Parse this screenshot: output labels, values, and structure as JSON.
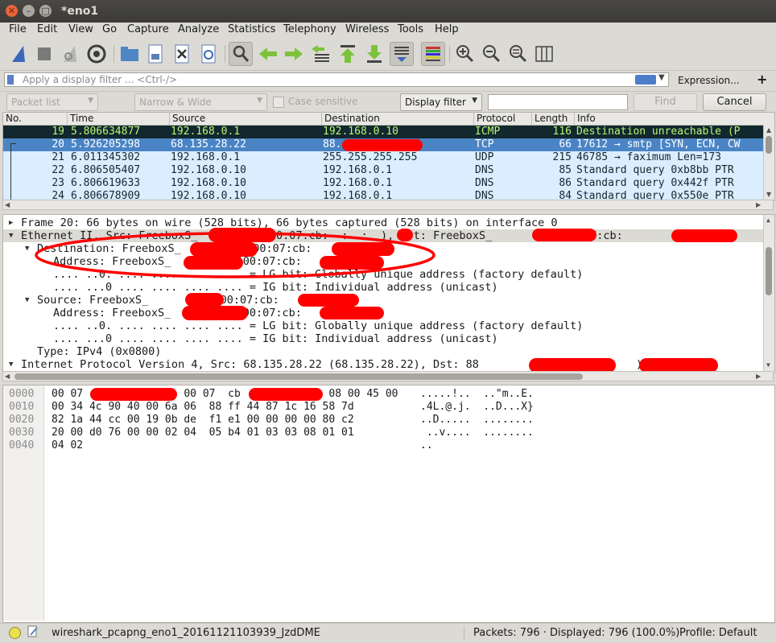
{
  "window": {
    "title": "*eno1"
  },
  "menu": [
    "File",
    "Edit",
    "View",
    "Go",
    "Capture",
    "Analyze",
    "Statistics",
    "Telephony",
    "Wireless",
    "Tools",
    "Help"
  ],
  "toolbar_icons": [
    "shark-fin-start-icon",
    "stop-square-icon",
    "restart-fin-icon",
    "gear-options-icon",
    "folder-open-icon",
    "file-save-icon",
    "file-close-icon",
    "reload-icon",
    "search-magnifier-icon",
    "arrow-back-icon",
    "arrow-forward-icon",
    "jump-to-packet-icon",
    "go-first-icon",
    "go-last-icon",
    "autoscroll-icon",
    "colorize-icon",
    "zoom-in-icon",
    "zoom-out-icon",
    "zoom-normal-icon",
    "resize-columns-icon"
  ],
  "filter": {
    "placeholder": "Apply a display filter ... <Ctrl-/>",
    "expression_label": "Expression...",
    "add_label": "+"
  },
  "find": {
    "search_in": "Packet list",
    "char_width": "Narrow & Wide",
    "case_label": "Case sensitive",
    "search_type": "Display filter",
    "find_label": "Find",
    "cancel_label": "Cancel"
  },
  "packet_list": {
    "columns": [
      "No.",
      "Time",
      "Source",
      "Destination",
      "Protocol",
      "Length",
      "Info"
    ],
    "rows": [
      {
        "no": "19",
        "time": "5.806634877",
        "src": "192.168.0.1",
        "dst": "192.168.0.10",
        "proto": "ICMP",
        "len": "116",
        "info": "Destination unreachable (P",
        "style": "icmp"
      },
      {
        "no": "20",
        "time": "5.926205298",
        "src": "68.135.28.22",
        "dst": "88.",
        "proto": "TCP",
        "len": "66",
        "info": "17612 → smtp [SYN, ECN, CW",
        "style": "selected"
      },
      {
        "no": "21",
        "time": "6.011345302",
        "src": "192.168.0.1",
        "dst": "255.255.255.255",
        "proto": "UDP",
        "len": "215",
        "info": "46785 → faximum  Len=173",
        "style": "udp"
      },
      {
        "no": "22",
        "time": "6.806505407",
        "src": "192.168.0.10",
        "dst": "192.168.0.1",
        "proto": "DNS",
        "len": "85",
        "info": "Standard query 0xb8bb PTR",
        "style": "udp"
      },
      {
        "no": "23",
        "time": "6.806619633",
        "src": "192.168.0.10",
        "dst": "192.168.0.1",
        "proto": "DNS",
        "len": "86",
        "info": "Standard query 0x442f PTR",
        "style": "udp"
      },
      {
        "no": "24",
        "time": "6.806678909",
        "src": "192.168.0.10",
        "dst": "192.168.0.1",
        "proto": "DNS",
        "len": "84",
        "info": "Standard query 0x550e PTR",
        "style": "udp"
      }
    ]
  },
  "details": [
    {
      "text": "Frame 20: 66 bytes on wire (528 bits), 66 bytes captured (528 bits) on interface 0",
      "indent": 0,
      "tri": "collapsed"
    },
    {
      "text": "Ethernet II, Src: FreeboxS_          (00:07:cb:  :  :  ), Dst: FreeboxS_          (00:07:cb:",
      "indent": 0,
      "tri": "expanded",
      "selected": true
    },
    {
      "text": "Destination: FreeboxS_          (00:07:cb:         )",
      "indent": 1,
      "tri": "expanded"
    },
    {
      "text": "Address: FreeboxS_          (00:07:cb:         )",
      "indent": 2,
      "tri": "none"
    },
    {
      "text": ".... ..0. .... .... .... .... = LG bit: Globally unique address (factory default)",
      "indent": 2,
      "tri": "none"
    },
    {
      "text": ".... ...0 .... .... .... .... = IG bit: Individual address (unicast)",
      "indent": 2,
      "tri": "none"
    },
    {
      "text": "Source: FreeboxS_          (00:07:cb:         )",
      "indent": 1,
      "tri": "expanded"
    },
    {
      "text": "Address: FreeboxS_          (00:07:cb:         )",
      "indent": 2,
      "tri": "none"
    },
    {
      "text": ".... ..0. .... .... .... .... = LG bit: Globally unique address (factory default)",
      "indent": 2,
      "tri": "none"
    },
    {
      "text": ".... ...0 .... .... .... .... = IG bit: Individual address (unicast)",
      "indent": 2,
      "tri": "none"
    },
    {
      "text": "Type: IPv4 (0x0800)",
      "indent": 1,
      "tri": "none"
    },
    {
      "text": "Internet Protocol Version 4, Src: 68.135.28.22 (68.135.28.22), Dst: 88           (88          )",
      "indent": 0,
      "tri": "expanded"
    }
  ],
  "bytes": [
    {
      "off": "0000",
      "hex": "00 07                00 07  cb              08 00 45 00",
      "ascii": ".....!..  ..\"m..E."
    },
    {
      "off": "0010",
      "hex": "00 34 4c 90 40 00 6a 06  88 ff 44 87 1c 16 58 7d",
      "ascii": ".4L.@.j.  ..D...X}"
    },
    {
      "off": "0020",
      "hex": "82 1a 44 cc 00 19 0b de  f1 e1 00 00 00 00 80 c2",
      "ascii": "..D.....  ........"
    },
    {
      "off": "0030",
      "hex": "20 00 d0 76 00 00 02 04  05 b4 01 03 03 08 01 01",
      "ascii": " ..v....  ........"
    },
    {
      "off": "0040",
      "hex": "04 02",
      "ascii": ".."
    }
  ],
  "status": {
    "file": "wireshark_pcapng_eno1_20161121103939_JzdDME",
    "packets": "Packets: 796 · Displayed: 796 (100.0%)",
    "profile": "Profile: Default"
  },
  "colors": {
    "icmp_bg": "#12272e",
    "icmp_fg": "#b7f774",
    "selected_bg": "#4a84c5",
    "selected_fg": "#ffffff",
    "udp_bg": "#daeeff",
    "redaction": "#ff0000"
  }
}
